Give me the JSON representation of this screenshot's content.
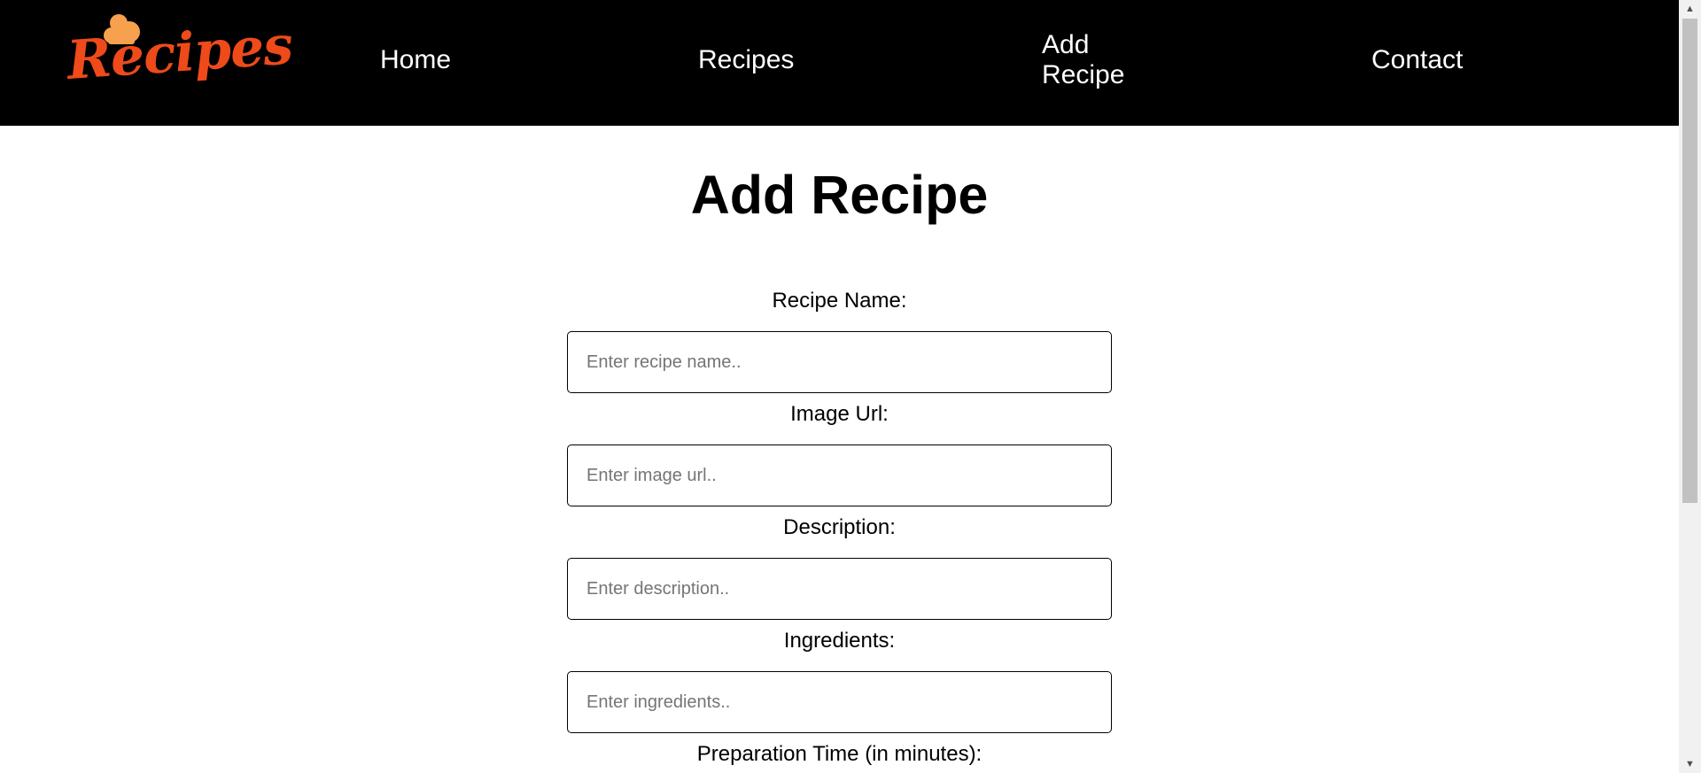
{
  "brand": {
    "logo_text": "Recipes",
    "logo_color": "#ee4a1a",
    "hat_color": "#f7a04e"
  },
  "nav": {
    "items": [
      {
        "label": "Home"
      },
      {
        "label": "Recipes"
      },
      {
        "label": "Add Recipe"
      },
      {
        "label": "Contact"
      }
    ]
  },
  "page": {
    "title": "Add Recipe"
  },
  "form": {
    "fields": [
      {
        "label": "Recipe Name:",
        "placeholder": "Enter recipe name..",
        "value": ""
      },
      {
        "label": "Image Url:",
        "placeholder": "Enter image url..",
        "value": ""
      },
      {
        "label": "Description:",
        "placeholder": "Enter description..",
        "value": ""
      },
      {
        "label": "Ingredients:",
        "placeholder": "Enter ingredients..",
        "value": ""
      },
      {
        "label": "Preparation Time (in minutes):"
      }
    ]
  },
  "scrollbar": {
    "up_icon": "triangle-up-icon",
    "down_icon": "triangle-down-icon"
  }
}
